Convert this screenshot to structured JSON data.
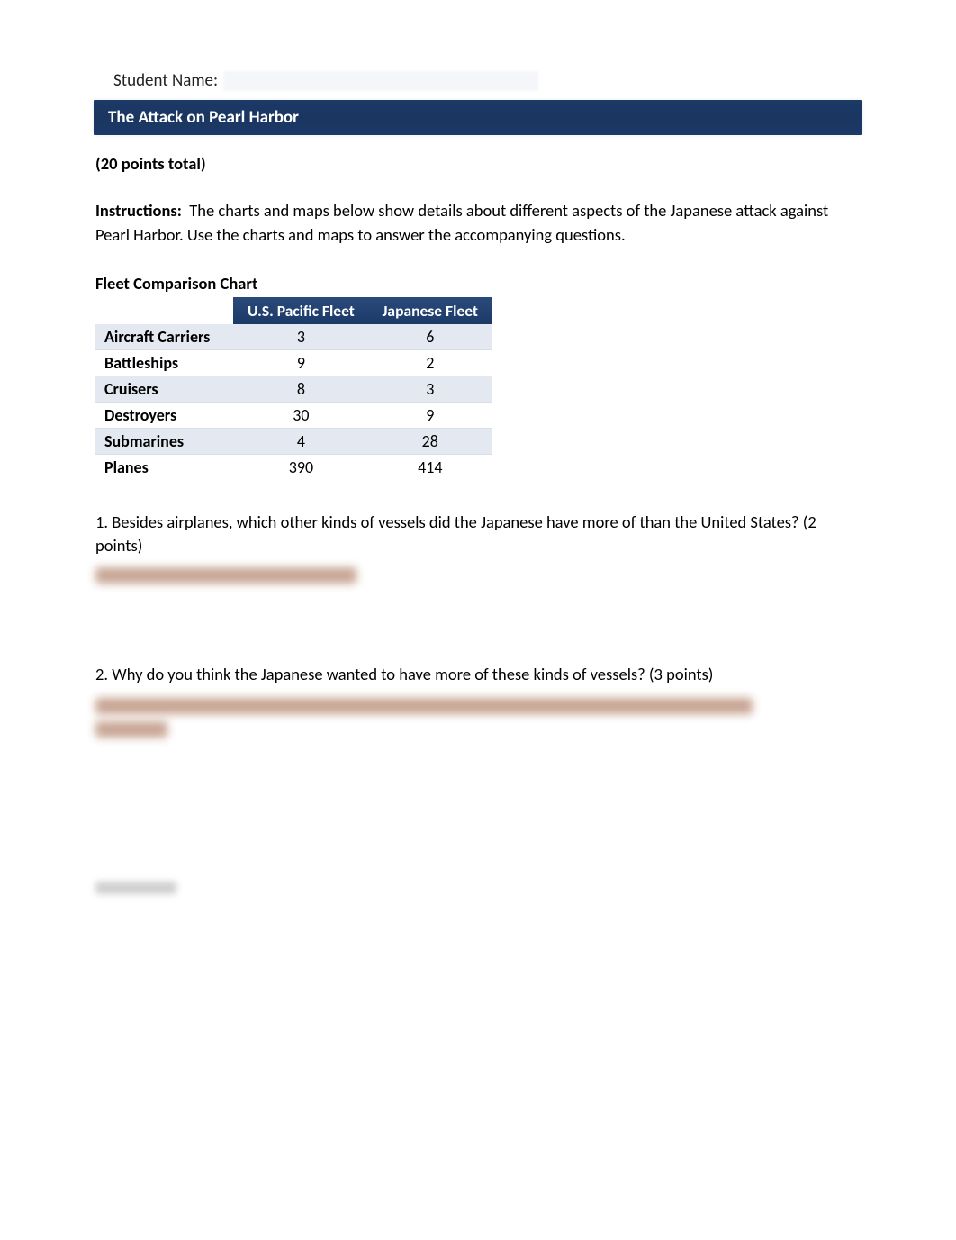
{
  "student": {
    "label": "Student Name:"
  },
  "titleBar": "The Attack on Pearl Harbor",
  "points": "(20 points total)",
  "instructions": {
    "label": "Instructions:",
    "text": "The charts and maps below show details about different aspects of the Japanese attack against Pearl Harbor. Use the charts and maps to answer the accompanying questions."
  },
  "chart_data": {
    "type": "table",
    "title": "Fleet Comparison Chart",
    "columns": [
      "",
      "U.S. Pacific Fleet",
      "Japanese Fleet"
    ],
    "rows": [
      {
        "label": "Aircraft Carriers",
        "us": "3",
        "jp": "6"
      },
      {
        "label": "Battleships",
        "us": "9",
        "jp": "2"
      },
      {
        "label": "Cruisers",
        "us": "8",
        "jp": "3"
      },
      {
        "label": "Destroyers",
        "us": "30",
        "jp": "9"
      },
      {
        "label": "Submarines",
        "us": "4",
        "jp": "28"
      },
      {
        "label": "Planes",
        "us": "390",
        "jp": "414"
      }
    ]
  },
  "questions": {
    "q1": "1. Besides airplanes, which other kinds of vessels did the Japanese have more of than the United States? (2 points)",
    "q2": "2. Why do you think the Japanese wanted to have more of these kinds of vessels? (3 points)"
  }
}
